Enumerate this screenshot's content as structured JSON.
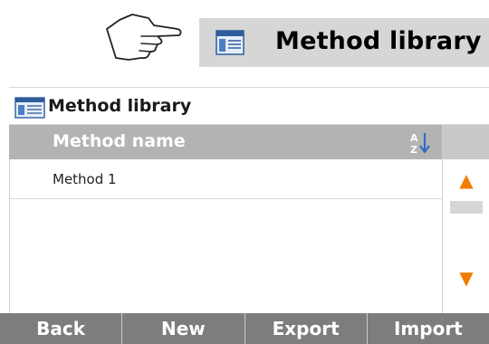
{
  "banner": {
    "title": "Method library"
  },
  "screen": {
    "header_title": "Method library",
    "column_header": "Method name",
    "rows": [
      {
        "label": "Method 1"
      }
    ]
  },
  "scroll": {
    "up_glyph": "▲",
    "down_glyph": "▼"
  },
  "buttons": {
    "back": "Back",
    "new": "New",
    "export": "Export",
    "import": "Import"
  },
  "colors": {
    "accent": "#f07d00",
    "column_header_bg": "#b3b3b3",
    "button_bar_bg": "#7d7d7d"
  },
  "icons": {
    "banner": "method-library-icon",
    "header": "method-library-icon",
    "sort": "sort-az-icon",
    "pointer": "pointing-hand-icon"
  }
}
